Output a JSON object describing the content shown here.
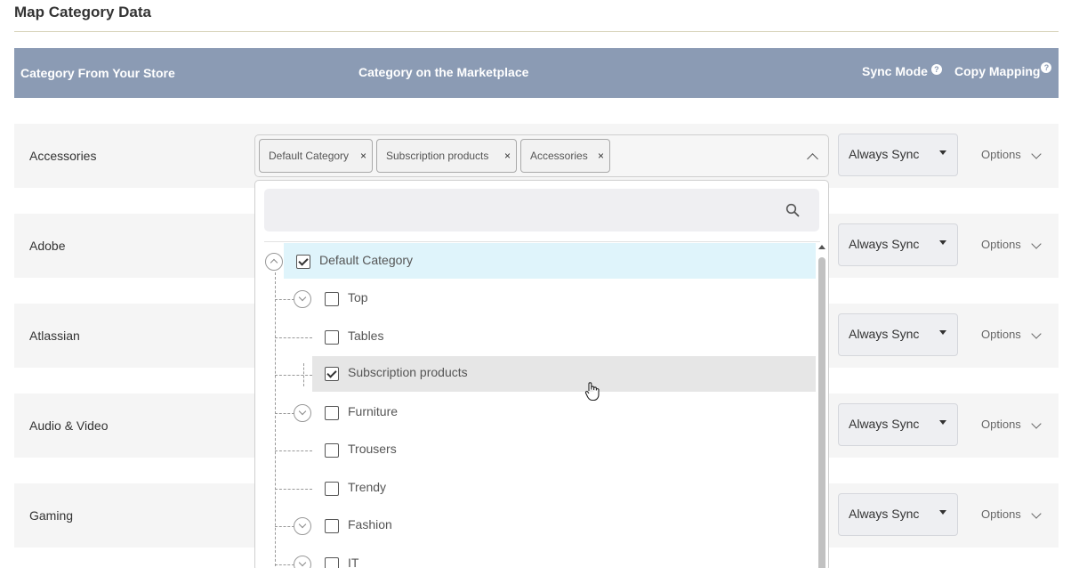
{
  "section_title": "Map Category Data",
  "table_header": {
    "store_category": "Category From Your Store",
    "marketplace_category": "Category on the Marketplace",
    "sync_mode": "Sync Mode",
    "copy_mapping": "Copy Mapping"
  },
  "rows": [
    {
      "label": "Accessories",
      "sync": "Always Sync",
      "options": "Options"
    },
    {
      "label": "Adobe",
      "sync": "Always Sync",
      "options": "Options"
    },
    {
      "label": "Atlassian",
      "sync": "Always Sync",
      "options": "Options"
    },
    {
      "label": "Audio & Video",
      "sync": "Always Sync",
      "options": "Options"
    },
    {
      "label": "Gaming",
      "sync": "Always Sync",
      "options": "Options"
    }
  ],
  "selected_tags": [
    "Default Category",
    "Subscription products",
    "Accessories"
  ],
  "tag_remove": "×",
  "search": {
    "placeholder": "",
    "icon": "search-icon"
  },
  "tree": [
    {
      "label": "Default Category",
      "checked": true,
      "expanded": true
    },
    {
      "label": "Top",
      "checked": false
    },
    {
      "label": "Tables",
      "checked": false
    },
    {
      "label": "Subscription products",
      "checked": true
    },
    {
      "label": "Furniture",
      "checked": false
    },
    {
      "label": "Trousers",
      "checked": false
    },
    {
      "label": "Trendy",
      "checked": false
    },
    {
      "label": "Fashion",
      "checked": false
    },
    {
      "label": "IT",
      "checked": false
    }
  ],
  "colors": {
    "header_bg": "#8b9bb4",
    "selected_root_bg": "#dff4fb",
    "hover_bg": "#e6e6e6",
    "row_bg": "#f5f5f5"
  }
}
